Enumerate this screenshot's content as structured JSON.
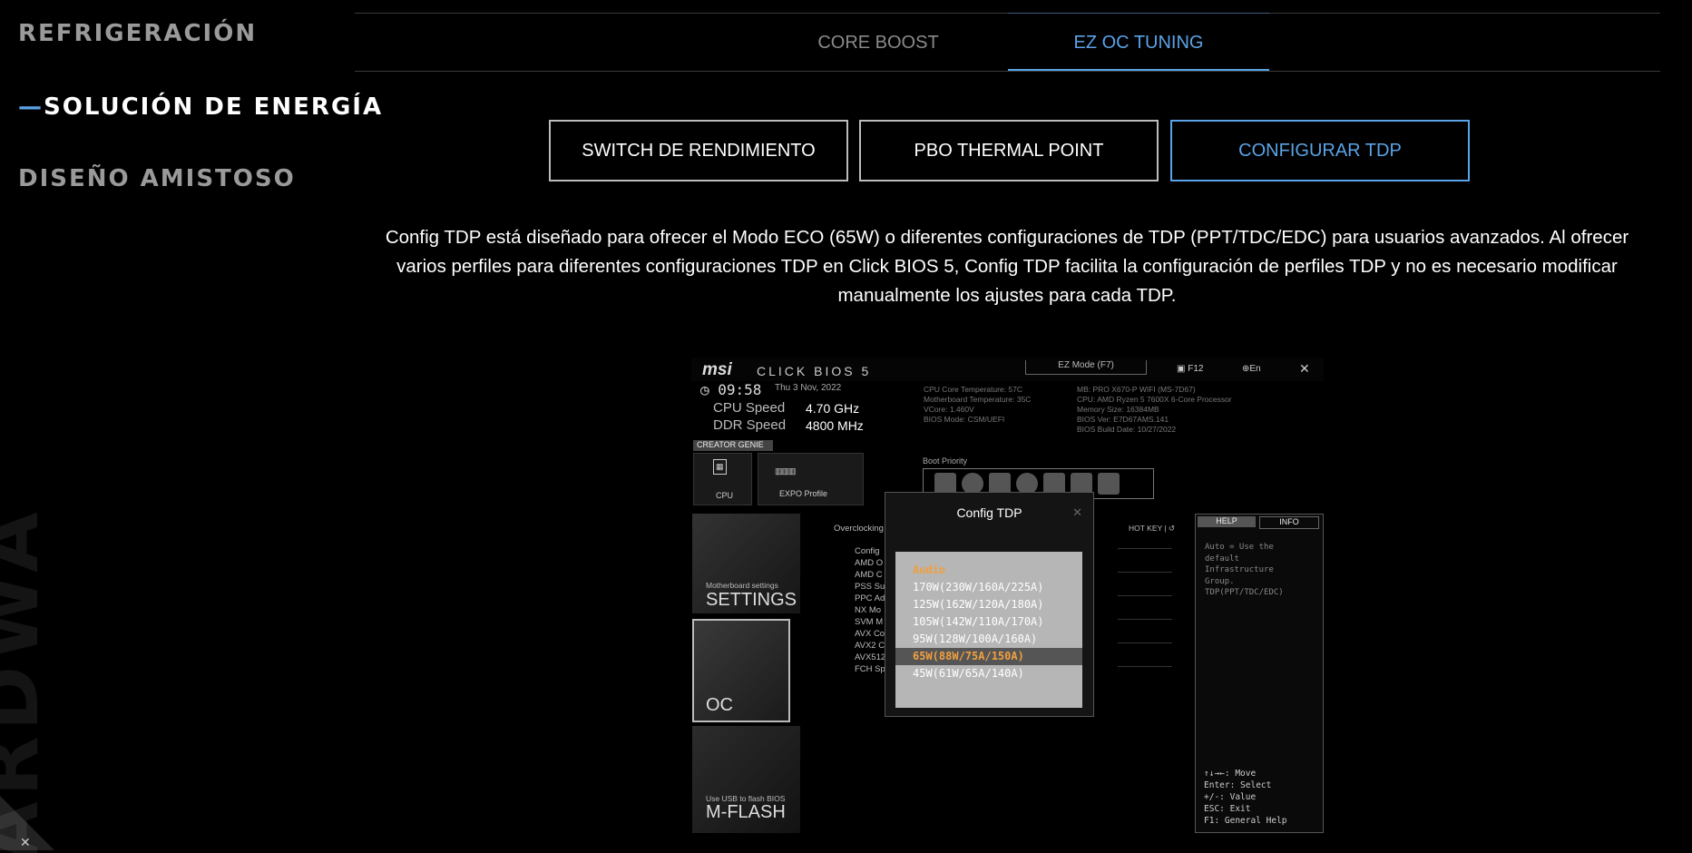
{
  "sidebar": {
    "items": [
      {
        "label": "REFRIGERACIÓN",
        "state": "inactive"
      },
      {
        "prefix": "—",
        "label": "SOLUCIÓN DE ENERGÍA",
        "state": "active"
      },
      {
        "label": "DISEÑO AMISTOSO",
        "state": "inactive"
      }
    ],
    "bg_text": "ARDWARE"
  },
  "tabs": [
    {
      "label": "CORE BOOST",
      "active": false
    },
    {
      "label": "EZ OC TUNING",
      "active": true
    }
  ],
  "buttons": [
    {
      "label": "SWITCH DE RENDIMIENTO",
      "active": false
    },
    {
      "label": "PBO THERMAL POINT",
      "active": false
    },
    {
      "label": "CONFIGURAR TDP",
      "active": true
    }
  ],
  "description": "Config TDP está diseñado para ofrecer el Modo ECO (65W) o diferentes configuraciones de TDP (PPT/TDC/EDC) para usuarios avanzados. Al ofrecer varios perfiles para diferentes configuraciones TDP en Click BIOS 5, Config TDP facilita la configuración de perfiles TDP y no es necesario modificar manualmente los ajustes para cada TDP.",
  "bios": {
    "logo": "msi",
    "product": "CLICK BIOS 5",
    "ez_mode": "EZ Mode (F7)",
    "f12": "F12",
    "lang": "En",
    "close": "✕",
    "time": "09:58",
    "date": "Thu 3 Nov, 2022",
    "cpu_speed_label": "CPU Speed",
    "cpu_speed_value": "4.70 GHz",
    "ddr_speed_label": "DDR Speed",
    "ddr_speed_value": "4800 MHz",
    "sysinfo_left": [
      "CPU Core Temperature: 57C",
      "Motherboard Temperature: 35C",
      "VCore: 1.460V",
      "BIOS Mode: CSM/UEFI"
    ],
    "sysinfo_right": [
      "MB: PRO X670-P WIFI (MS-7D67)",
      "CPU: AMD Ryzen 5 7600X 6-Core Processor",
      "Memory Size: 16384MB",
      "BIOS Ver: E7D67AMS.141",
      "BIOS Build Date: 10/27/2022"
    ],
    "creator_genie": "CREATOR GENIE",
    "tile_cpu": "CPU",
    "tile_expo": "EXPO Profile",
    "boot_priority": "Boot Priority",
    "settings_small": "Motherboard settings",
    "settings_big": "SETTINGS",
    "oc_big": "OC",
    "mflash_small": "Use USB to flash BIOS",
    "mflash_big": "M-FLASH",
    "overclocking": "Overclocking",
    "hotkey": "HOT KEY | ↺",
    "menu_items": [
      "Config",
      "AMD O",
      "AMD C",
      "PSS Su",
      "PPC Ad",
      "NX Mo",
      "SVM M",
      "AVX Co",
      "AVX2 C",
      "AVX512",
      "FCH Sp"
    ],
    "help_tab": "HELP",
    "info_tab": "INFO",
    "help_text": [
      "Auto = Use the",
      "default",
      "Infrastructure",
      "Group.",
      "TDP(PPT/TDC/EDC)"
    ],
    "keys": [
      "↑↓→←: Move",
      "Enter: Select",
      "+/-: Value",
      "ESC: Exit",
      "F1: General Help"
    ],
    "modal": {
      "title": "Config TDP",
      "close": "✕",
      "options": [
        {
          "label": "Audio",
          "style": "highlight"
        },
        {
          "label": "170W(230W/160A/225A)",
          "style": "normal"
        },
        {
          "label": "125W(162W/120A/180A)",
          "style": "normal"
        },
        {
          "label": "105W(142W/110A/170A)",
          "style": "normal"
        },
        {
          "label": "95W(128W/100A/160A)",
          "style": "normal"
        },
        {
          "label": "65W(88W/75A/150A)",
          "style": "selected"
        },
        {
          "label": "45W(61W/65A/140A)",
          "style": "normal"
        }
      ]
    }
  },
  "colors": {
    "accent": "#5aa3e6",
    "highlight": "#f0a040"
  }
}
